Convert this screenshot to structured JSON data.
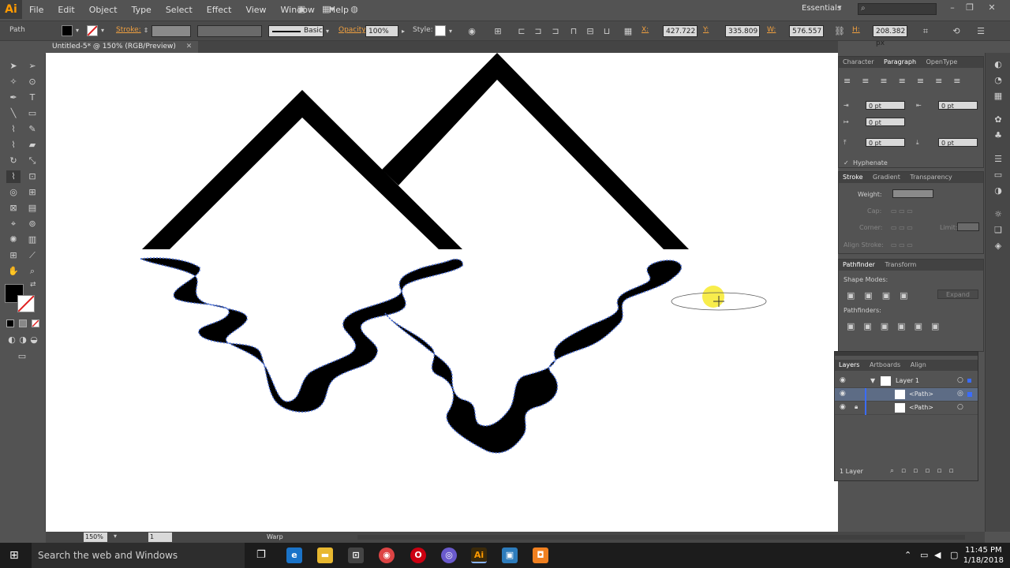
{
  "app": {
    "logo": "Ai",
    "menu": [
      "File",
      "Edit",
      "Object",
      "Type",
      "Select",
      "Effect",
      "View",
      "Window",
      "Help"
    ],
    "workspace": "Essentials"
  },
  "control_bar": {
    "selection_type": "Path",
    "stroke_label": "Stroke:",
    "brush_label": "Basic",
    "opacity_label": "Opacity:",
    "opacity_value": "100%",
    "style_label": "Style:",
    "x_label": "X:",
    "x_value": "427.722 px",
    "y_label": "Y:",
    "y_value": "335.809 px",
    "w_label": "W:",
    "w_value": "576.557 px",
    "h_label": "H:",
    "h_value": "208.382 px"
  },
  "document": {
    "tab_title": "Untitled-5* @ 150% (RGB/Preview)"
  },
  "panels": {
    "character_tabs": [
      "Character",
      "Paragraph",
      "OpenType"
    ],
    "para_fields": [
      "0 pt",
      "0 pt",
      "0 pt",
      "0 pt",
      "0 pt"
    ],
    "hyphenate_label": "Hyphenate",
    "stroke_tabs": [
      "Stroke",
      "Gradient",
      "Transparency"
    ],
    "weight_label": "Weight:",
    "cap_label": "Cap:",
    "corner_label": "Corner:",
    "limit_label": "Limit:",
    "align_stroke_label": "Align Stroke:",
    "pathfinder_tabs": [
      "Pathfinder",
      "Transform"
    ],
    "shape_modes_label": "Shape Modes:",
    "pathfinders_label": "Pathfinders:",
    "expand_label": "Expand",
    "layers_tabs": [
      "Layers",
      "Artboards",
      "Align"
    ],
    "layers": [
      {
        "name": "Layer 1"
      },
      {
        "name": "<Path>"
      },
      {
        "name": "<Path>"
      }
    ],
    "layers_count": "1 Layer"
  },
  "status": {
    "zoom": "150%",
    "artboard": "1",
    "tool": "Warp"
  },
  "taskbar": {
    "search_placeholder": "Search the web and Windows",
    "time": "11:45 PM",
    "date": "1/18/2018"
  },
  "colors": {
    "path_selection": "#4a6fd8",
    "ai_orange": "#ff9a00",
    "cursor_highlight": "#f5e600"
  }
}
